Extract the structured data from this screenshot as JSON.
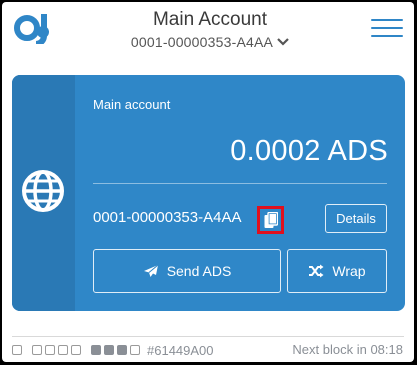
{
  "header": {
    "title": "Main Account",
    "address": "0001-00000353-A4AA"
  },
  "card": {
    "account_label": "Main account",
    "balance": "0.0002 ADS",
    "address": "0001-00000353-A4AA",
    "details_label": "Details",
    "send_label": "Send ADS",
    "wrap_label": "Wrap"
  },
  "footer": {
    "block_id": "#61449A00",
    "next_block": "Next block in 08:18"
  },
  "colors": {
    "accent": "#2f86c7",
    "card": "#2f87c8",
    "card_side": "#2a79b5",
    "highlight": "#e0101e"
  },
  "icons": {
    "logo": "ads-logo-icon",
    "menu": "hamburger-menu-icon",
    "chevron": "chevron-down-icon",
    "globe": "globe-icon",
    "copy": "copy-icon",
    "send": "paper-plane-icon",
    "wrap": "shuffle-icon"
  }
}
